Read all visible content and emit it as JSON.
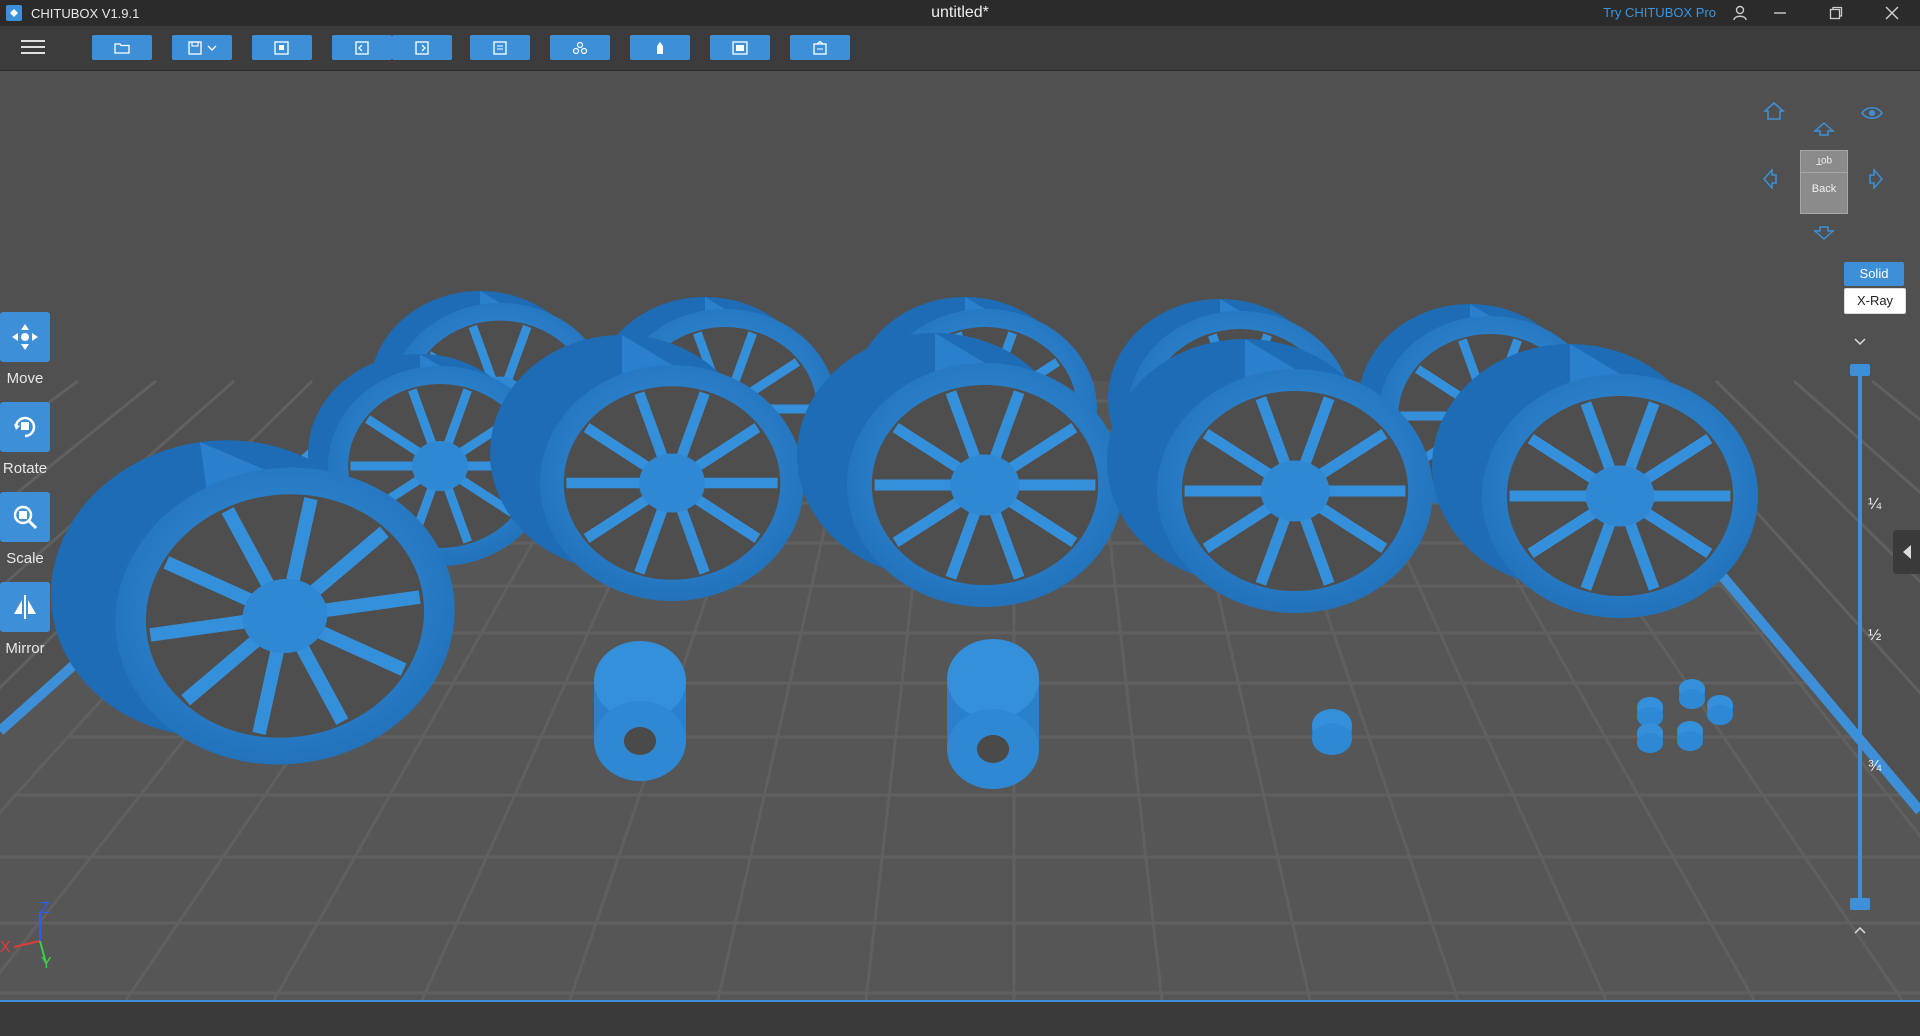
{
  "app": {
    "name": "CHITUBOX V1.9.1",
    "document_title": "untitled*",
    "try_pro": "Try CHITUBOX Pro"
  },
  "toolbar": {
    "buttons": [
      "open-file",
      "save",
      "import-models",
      "undo",
      "redo",
      "settings",
      "support-settings",
      "auto-arrange",
      "slice",
      "export"
    ]
  },
  "left_tools": [
    {
      "label": "Move"
    },
    {
      "label": "Rotate"
    },
    {
      "label": "Scale"
    },
    {
      "label": "Mirror"
    }
  ],
  "view_cube": {
    "top_face": "Top",
    "front_face": "Back"
  },
  "render_modes": {
    "solid": "Solid",
    "xray": "X-Ray",
    "active": "Solid"
  },
  "layer_slider": {
    "marks": [
      "¼",
      "½",
      "¾"
    ],
    "value": 1.0
  },
  "axes": {
    "x": "X",
    "y": "Y",
    "z": "Z"
  },
  "colors": {
    "accent": "#3d8fd8",
    "model": "#2f88d4",
    "grid": "#606060"
  }
}
